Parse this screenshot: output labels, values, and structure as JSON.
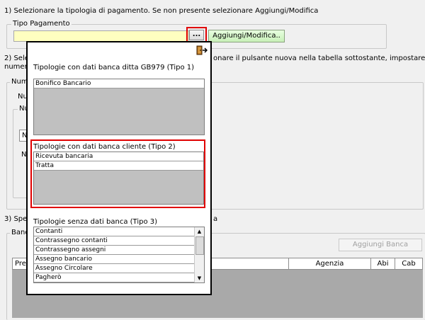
{
  "step1": {
    "instruction": "1) Selezionare la tipologia di pagamento. Se non presente selezionare Aggiungi/Modifica",
    "group_title": "Tipo Pagamento",
    "field_value": "",
    "ellipsis_label": "...",
    "add_modify_label": "Aggiungi/Modifica.."
  },
  "step2": {
    "instruction_prefix": "2) Sele",
    "instruction_suffix": "onare il pulsante nuova nella tabella sottostante, impostare il",
    "instruction_line2": "numer",
    "group_num": "Num",
    "label_nu": "Nu",
    "label_nu2": "Nu",
    "label_n": "N",
    "label_n2": "N"
  },
  "step3": {
    "instruction_prefix": "3) Spe",
    "instruction_suffix": "a",
    "group_banche": "Banc",
    "add_bank_label": "Aggiungi Banca",
    "columns": {
      "c1": "Pred",
      "agenzia": "Agenzia",
      "abi": "Abi",
      "cab": "Cab"
    }
  },
  "popup": {
    "exit_icon": "exit-door-icon",
    "section1": {
      "title": "Tipologie con dati banca ditta GB979 (Tipo 1)",
      "items": [
        "Bonifico Bancario"
      ]
    },
    "section2": {
      "title": "Tipologie con dati banca cliente (Tipo 2)",
      "items": [
        "Ricevuta bancaria",
        "Tratta"
      ]
    },
    "section3": {
      "title": "Tipologie senza dati banca (Tipo 3)",
      "items": [
        "Contanti",
        "Contrassegno contanti",
        "Contrassegno assegni",
        "Assegno bancario",
        "Assegno Circolare",
        "Pagherò"
      ]
    }
  },
  "colors": {
    "highlight_red": "#e00000",
    "field_yellow": "#ffffc0",
    "list_gray": "#c0c0c0"
  }
}
